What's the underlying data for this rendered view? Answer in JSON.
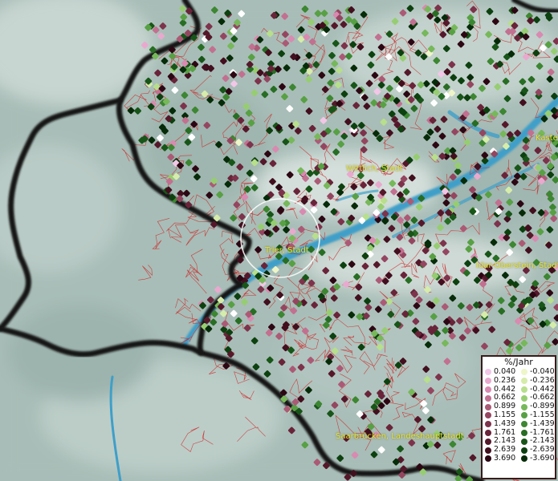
{
  "map": {
    "cities": [
      {
        "name": "Wittlich, Stadt"
      },
      {
        "name": "Trier, Stadt"
      },
      {
        "name": "Idar-Oberstein, Stadt"
      },
      {
        "name": "Saarbrücken, Landeshauptstadt"
      },
      {
        "name": "Kaste"
      }
    ],
    "colors": {
      "terrain": "#a9bdb8",
      "river": "#3f9fc8",
      "border": "#1a1a1a",
      "municipal_lines": "#cc2a2a",
      "label": "#e6e22c"
    }
  },
  "legend": {
    "title": "%/Jahr",
    "positive": [
      {
        "label": "0.040",
        "color": "#f2c6e6"
      },
      {
        "label": "0.236",
        "color": "#e9a9cf"
      },
      {
        "label": "0.442",
        "color": "#d98ab0"
      },
      {
        "label": "0.662",
        "color": "#c27090"
      },
      {
        "label": "0.899",
        "color": "#ab5a76"
      },
      {
        "label": "1.155",
        "color": "#944660"
      },
      {
        "label": "1.439",
        "color": "#7d334b"
      },
      {
        "label": "1.761",
        "color": "#69243a"
      },
      {
        "label": "2.143",
        "color": "#55182b"
      },
      {
        "label": "2.639",
        "color": "#420f1f"
      },
      {
        "label": "3.690",
        "color": "#2c0713"
      }
    ],
    "negative": [
      {
        "label": "-0.040",
        "color": "#eef5c8"
      },
      {
        "label": "-0.236",
        "color": "#d6ecaa"
      },
      {
        "label": "-0.442",
        "color": "#b7df8c"
      },
      {
        "label": "-0.662",
        "color": "#97cd72"
      },
      {
        "label": "-0.899",
        "color": "#77b85a"
      },
      {
        "label": "-1.155",
        "color": "#58a044"
      },
      {
        "label": "-1.439",
        "color": "#3d8632"
      },
      {
        "label": "-1.761",
        "color": "#286d24"
      },
      {
        "label": "-2.143",
        "color": "#185518"
      },
      {
        "label": "-2.639",
        "color": "#0d400f"
      },
      {
        "label": "-3.690",
        "color": "#062b08"
      }
    ]
  }
}
